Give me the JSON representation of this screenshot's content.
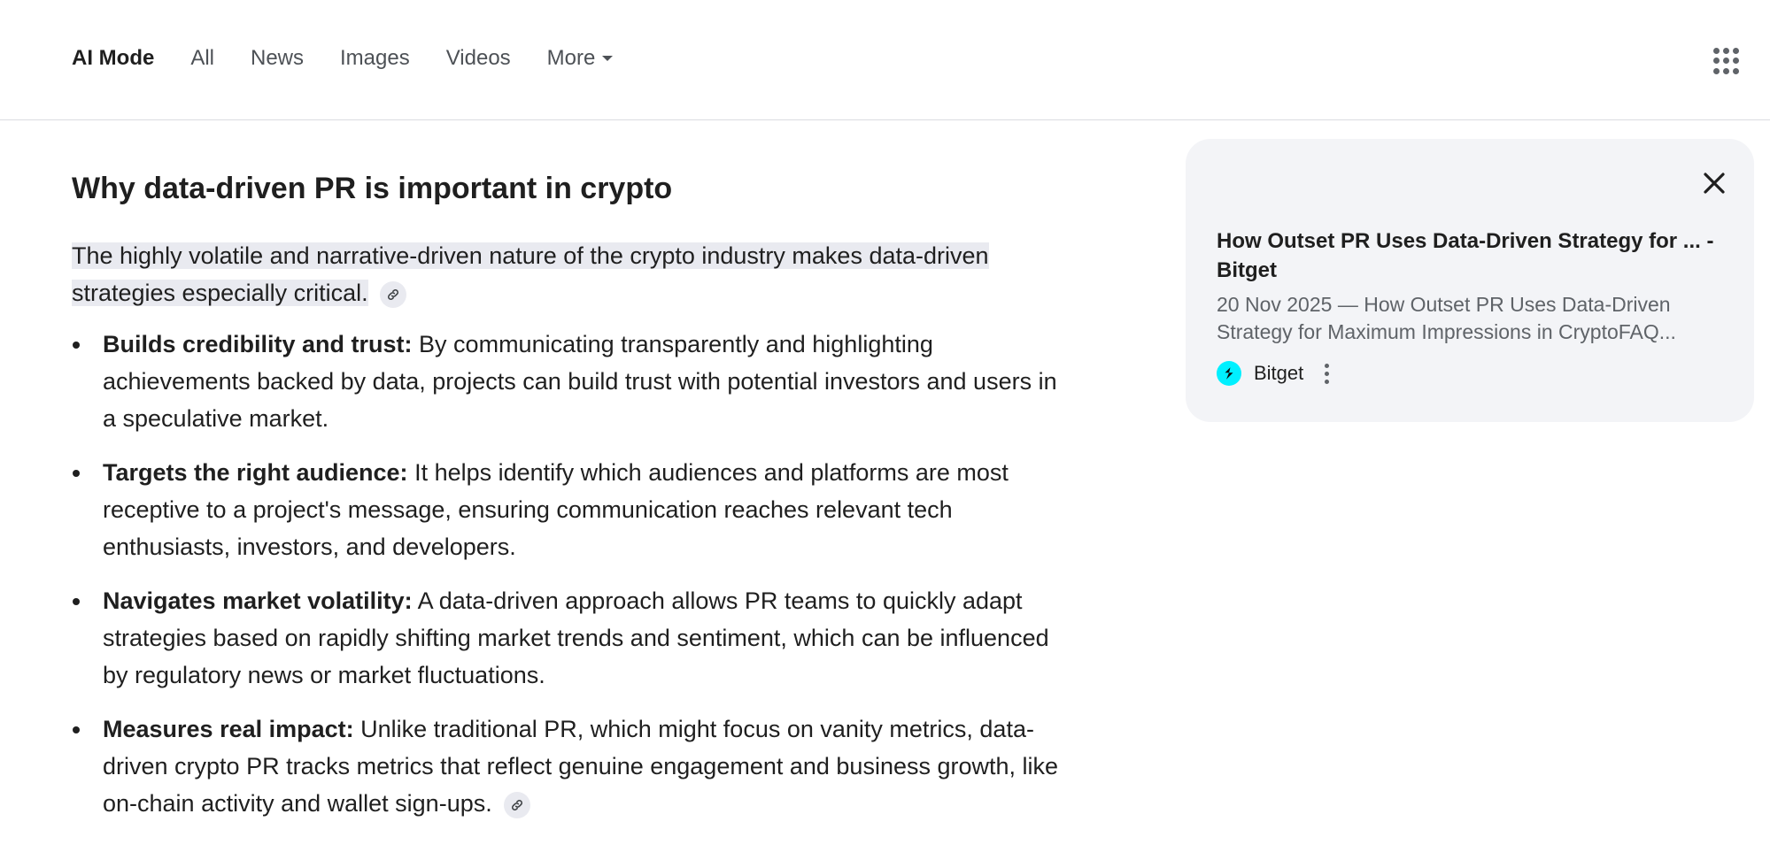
{
  "nav": {
    "tabs": [
      {
        "label": "AI Mode",
        "active": true
      },
      {
        "label": "All"
      },
      {
        "label": "News"
      },
      {
        "label": "Images"
      },
      {
        "label": "Videos"
      }
    ],
    "more_label": "More"
  },
  "answer": {
    "heading": "Why data-driven PR is important in crypto",
    "intro": "The highly volatile and narrative-driven nature of the crypto industry makes data-driven strategies especially critical.",
    "bullets": [
      {
        "title": "Builds credibility and trust:",
        "text": " By communicating transparently and highlighting achievements backed by data, projects can build trust with potential investors and users in a speculative market."
      },
      {
        "title": "Targets the right audience:",
        "text": " It helps identify which audiences and platforms are most receptive to a project's message, ensuring communication reaches relevant tech enthusiasts, investors, and developers."
      },
      {
        "title": "Navigates market volatility:",
        "text": " A data-driven approach allows PR teams to quickly adapt strategies based on rapidly shifting market trends and sentiment, which can be influenced by regulatory news or market fluctuations."
      },
      {
        "title": "Measures real impact:",
        "text": " Unlike traditional PR, which might focus on vanity metrics, data-driven crypto PR tracks metrics that reflect genuine engagement and business growth, like on-chain activity and wallet sign-ups."
      }
    ]
  },
  "source_card": {
    "title": "How Outset PR Uses Data-Driven Strategy for ... - Bitget",
    "snippet": "20 Nov 2025 — How Outset PR Uses Data-Driven Strategy for Maximum Impressions in CryptoFAQ...",
    "source_name": "Bitget"
  },
  "icons": {
    "apps": "apps-grid-icon",
    "close": "close-icon",
    "link": "link-icon",
    "more": "more-vert-icon",
    "favicon": "bitget-favicon"
  },
  "colors": {
    "highlight": "#e9eaf0",
    "card_bg": "#f3f4f7",
    "favicon": "#00f0ff"
  }
}
